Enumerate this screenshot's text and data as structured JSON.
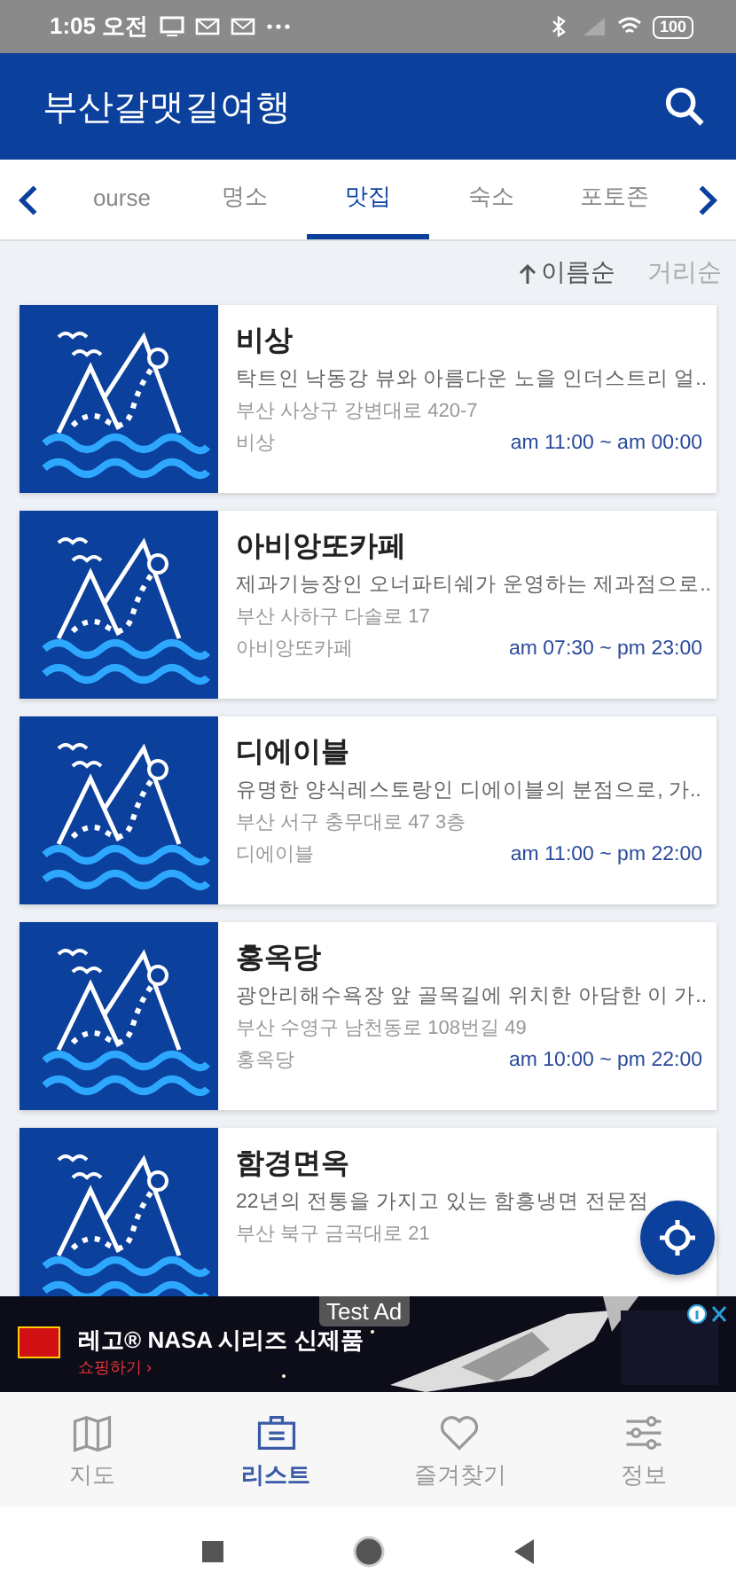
{
  "status_bar": {
    "time": "1:05 오전",
    "battery": "100"
  },
  "app_bar": {
    "title": "부산갈맷길여행"
  },
  "tabs": [
    {
      "label": "ourse",
      "selected": false
    },
    {
      "label": "명소",
      "selected": false
    },
    {
      "label": "맛집",
      "selected": true
    },
    {
      "label": "숙소",
      "selected": false
    },
    {
      "label": "포토존",
      "selected": false
    }
  ],
  "sort_options": [
    {
      "label": "이름순",
      "selected": true
    },
    {
      "label": "거리순",
      "selected": false
    }
  ],
  "places": [
    {
      "name": "비상",
      "description": "탁트인 낙동강 뷰와 아름다운 노을 인더스트리 얼..",
      "address": "부산 사상구 강변대로 420-7",
      "label": "비상",
      "hours": "am 11:00 ~ am 00:00"
    },
    {
      "name": "아비앙또카페",
      "description": "제과기능장인 오너파티쉐가 운영하는 제과점으로..",
      "address": "부산 사하구 다솔로 17",
      "label": "아비앙또카페",
      "hours": "am 07:30 ~ pm 23:00"
    },
    {
      "name": "디에이블",
      "description": "유명한 양식레스토랑인 디에이블의 분점으로, 가..",
      "address": "부산 서구 충무대로 47 3층",
      "label": "디에이블",
      "hours": "am 11:00 ~ pm 22:00"
    },
    {
      "name": "홍옥당",
      "description": "광안리해수욕장 앞 골목길에 위치한 아담한 이 가..",
      "address": "부산 수영구 남천동로 108번길 49",
      "label": "홍옥당",
      "hours": "am 10:00 ~ pm 22:00"
    },
    {
      "name": "함경면옥",
      "description": "22년의 전통을 가지고 있는 함흥냉면 전문점",
      "address": "부산 북구 금곡대로 21"
    }
  ],
  "ad": {
    "badge": "Test Ad",
    "headline": "레고® NASA 시리즈 신제품",
    "cta": "쇼핑하기 ›"
  },
  "bottom_nav": [
    {
      "label": "지도",
      "selected": false
    },
    {
      "label": "리스트",
      "selected": true
    },
    {
      "label": "즐겨찾기",
      "selected": false
    },
    {
      "label": "정보",
      "selected": false
    }
  ]
}
